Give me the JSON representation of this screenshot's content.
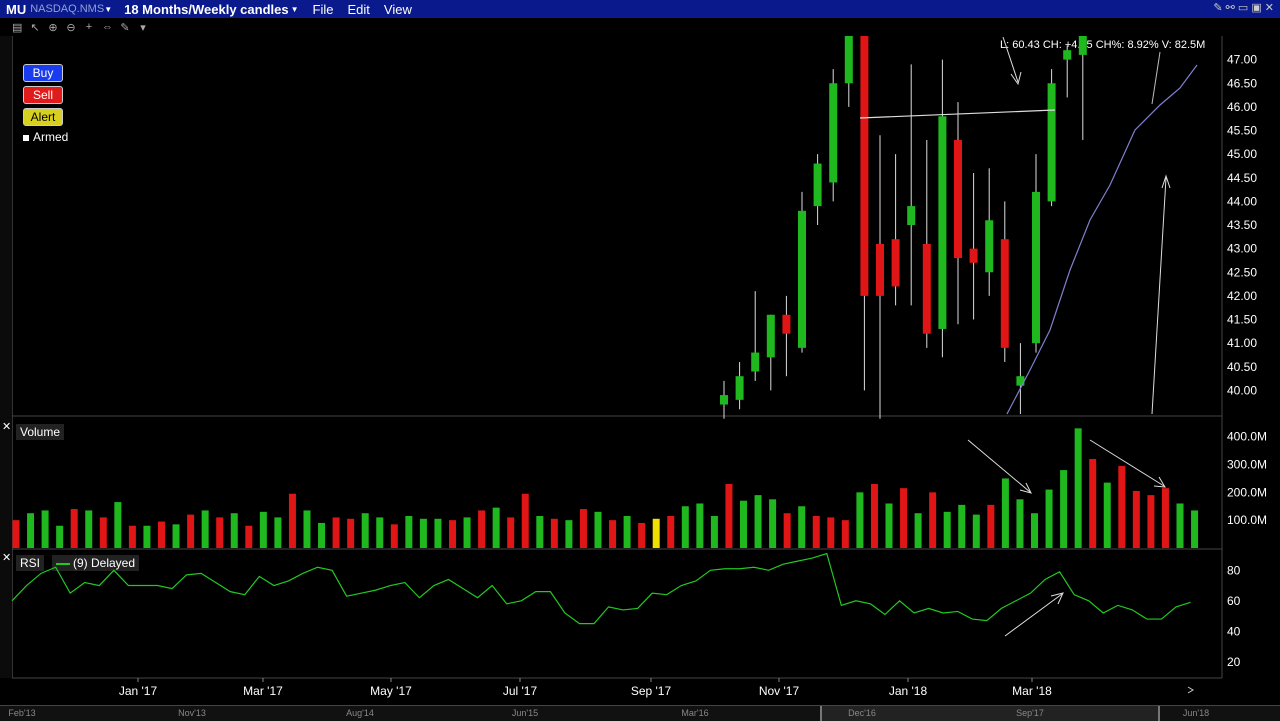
{
  "titlebar": {
    "symbol": "MU",
    "exchange": "NASDAQ.NMS",
    "period": "18 Months/Weekly candles",
    "menus": [
      "File",
      "Edit",
      "View"
    ]
  },
  "buttons": {
    "buy": "Buy",
    "sell": "Sell",
    "alert": "Alert",
    "armed": "Armed"
  },
  "readout": "L: 60.43 CH: +4.95 CH%: 8.92% V: 82.5M",
  "volume_label": "Volume",
  "rsi_label": "RSI",
  "rsi_legend": "(9) Delayed",
  "colors": {
    "up": "#1fb81f",
    "down": "#e01515",
    "highlight": "#f0e000",
    "rsi": "#22c822",
    "ma": "#8080d0",
    "annot": "#dddddd",
    "text": "#ffffff"
  },
  "chart_data": [
    {
      "type": "candlestick",
      "title": "MU 18 Months/Weekly candles",
      "ylim": [
        39.5,
        47.5
      ],
      "yticks": [
        "47.00",
        "46.50",
        "46.00",
        "45.50",
        "45.00",
        "44.50",
        "44.00",
        "43.50",
        "43.00",
        "42.50",
        "42.00",
        "41.50",
        "41.00",
        "40.50",
        "40.00"
      ],
      "candles": [
        {
          "i": 0,
          "o": 39.7,
          "h": 40.2,
          "l": 39.3,
          "c": 39.9
        },
        {
          "i": 1,
          "o": 39.8,
          "h": 40.6,
          "l": 39.6,
          "c": 40.3
        },
        {
          "i": 2,
          "o": 40.4,
          "h": 42.1,
          "l": 40.2,
          "c": 40.8
        },
        {
          "i": 3,
          "o": 40.7,
          "h": 41.6,
          "l": 40.0,
          "c": 41.6
        },
        {
          "i": 4,
          "o": 41.6,
          "h": 42.0,
          "l": 40.3,
          "c": 41.2
        },
        {
          "i": 5,
          "o": 40.9,
          "h": 44.2,
          "l": 40.8,
          "c": 43.8
        },
        {
          "i": 6,
          "o": 43.9,
          "h": 45.0,
          "l": 43.5,
          "c": 44.8
        },
        {
          "i": 7,
          "o": 44.4,
          "h": 46.8,
          "l": 44.0,
          "c": 46.5
        },
        {
          "i": 8,
          "o": 46.5,
          "h": 47.5,
          "l": 46.0,
          "c": 47.5
        },
        {
          "i": 9,
          "o": 47.5,
          "h": 47.5,
          "l": 40.0,
          "c": 42.0
        },
        {
          "i": 10,
          "o": 43.1,
          "h": 45.4,
          "l": 39.3,
          "c": 42.0
        },
        {
          "i": 11,
          "o": 43.2,
          "h": 45.0,
          "l": 41.8,
          "c": 42.2
        },
        {
          "i": 12,
          "o": 43.5,
          "h": 46.9,
          "l": 41.8,
          "c": 43.9
        },
        {
          "i": 13,
          "o": 43.1,
          "h": 45.3,
          "l": 40.9,
          "c": 41.2
        },
        {
          "i": 14,
          "o": 41.3,
          "h": 47.0,
          "l": 40.7,
          "c": 45.8
        },
        {
          "i": 15,
          "o": 45.3,
          "h": 46.1,
          "l": 41.4,
          "c": 42.8
        },
        {
          "i": 16,
          "o": 43.0,
          "h": 44.6,
          "l": 41.5,
          "c": 42.7
        },
        {
          "i": 17,
          "o": 42.5,
          "h": 44.7,
          "l": 42.0,
          "c": 43.6
        },
        {
          "i": 18,
          "o": 43.2,
          "h": 44.0,
          "l": 40.6,
          "c": 40.9
        },
        {
          "i": 19,
          "o": 40.1,
          "h": 41.0,
          "l": 39.5,
          "c": 40.3
        },
        {
          "i": 20,
          "o": 41.0,
          "h": 45.0,
          "l": 40.8,
          "c": 44.2
        },
        {
          "i": 21,
          "o": 44.0,
          "h": 46.8,
          "l": 43.9,
          "c": 46.5
        },
        {
          "i": 22,
          "o": 47.0,
          "h": 47.3,
          "l": 46.2,
          "c": 47.2
        },
        {
          "i": 23,
          "o": 47.1,
          "h": 47.5,
          "l": 45.3,
          "c": 47.5
        }
      ],
      "annotations": "hand-drawn arrows and resistance line near 46.00"
    },
    {
      "type": "bar",
      "title": "Volume",
      "ylim": [
        0,
        460
      ],
      "yticks": [
        "400.0M",
        "300.0M",
        "200.0M",
        "100.0M"
      ],
      "unit": "M",
      "values": [
        100,
        125,
        135,
        80,
        140,
        135,
        110,
        165,
        80,
        80,
        95,
        85,
        120,
        135,
        110,
        125,
        80,
        130,
        110,
        195,
        135,
        90,
        110,
        105,
        125,
        110,
        85,
        115,
        105,
        105,
        100,
        110,
        135,
        145,
        110,
        195,
        115,
        105,
        100,
        140,
        130,
        100,
        115,
        90,
        105,
        115,
        150,
        160,
        115,
        230,
        170,
        190,
        175,
        125,
        150,
        115,
        110,
        100,
        200,
        230,
        160,
        215,
        125,
        200,
        130,
        155,
        120,
        155,
        250,
        175,
        125,
        210,
        280,
        430,
        320,
        235,
        295,
        205,
        190,
        215,
        160,
        135
      ],
      "down": [
        0,
        4,
        6,
        8,
        10,
        12,
        14,
        16,
        19,
        22,
        23,
        26,
        30,
        32,
        34,
        35,
        37,
        39,
        41,
        43,
        45,
        49,
        53,
        55,
        56,
        57,
        59,
        61,
        63,
        67,
        74,
        76,
        77,
        78,
        79
      ],
      "highlight": [
        44
      ]
    },
    {
      "type": "line",
      "title": "RSI",
      "series_name": "(9) Delayed",
      "ylim": [
        10,
        92
      ],
      "yticks": [
        "80",
        "60",
        "40",
        "20"
      ],
      "values": [
        60,
        70,
        78,
        82,
        65,
        72,
        70,
        80,
        70,
        70,
        70,
        68,
        77,
        78,
        72,
        66,
        64,
        76,
        70,
        73,
        78,
        82,
        80,
        63,
        65,
        67,
        70,
        72,
        62,
        70,
        74,
        68,
        62,
        70,
        58,
        60,
        66,
        66,
        52,
        45,
        45,
        56,
        54,
        55,
        65,
        64,
        70,
        73,
        80,
        81,
        81,
        82,
        80,
        84,
        86,
        88,
        91,
        57,
        60,
        58,
        51,
        60,
        52,
        55,
        52,
        53,
        48,
        47,
        55,
        60,
        65,
        74,
        79,
        64,
        60,
        52,
        57,
        54,
        48,
        48,
        56,
        59
      ]
    }
  ],
  "xaxis": {
    "labels": [
      "Jan '17",
      "Mar '17",
      "May '17",
      "Jul '17",
      "Sep '17",
      "Nov '17",
      "Jan '18",
      "Mar '18"
    ]
  },
  "navigator": {
    "labels": [
      "Feb'13",
      "Nov'13",
      "Aug'14",
      "Jun'15",
      "Mar'16",
      "Dec'16",
      "Sep'17",
      "Jun'18"
    ]
  }
}
